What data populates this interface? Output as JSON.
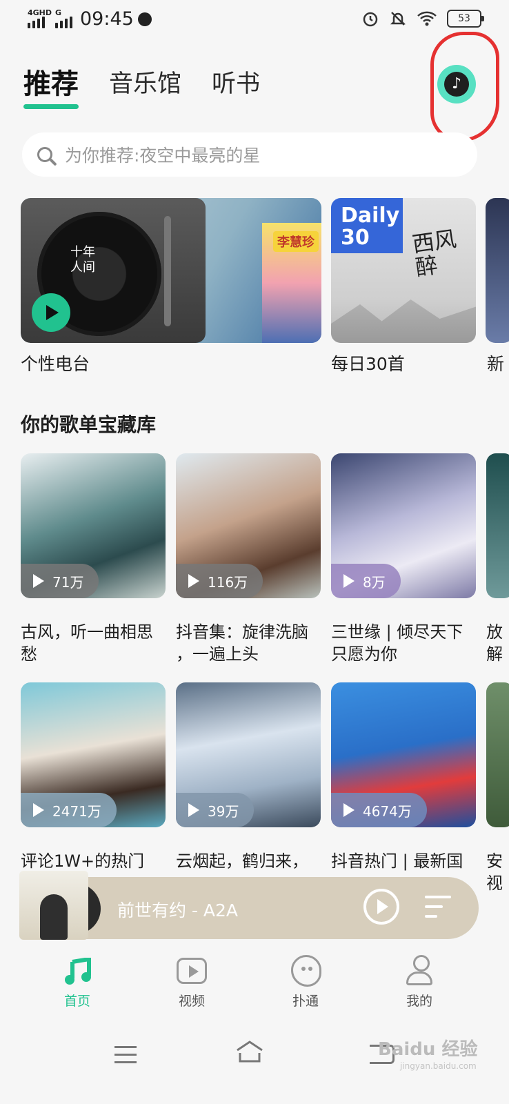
{
  "status_bar": {
    "network1": "4GHD",
    "network2": "G",
    "time": "09:45",
    "battery": "53"
  },
  "tabs": [
    {
      "label": "推荐",
      "active": true
    },
    {
      "label": "音乐馆",
      "active": false
    },
    {
      "label": "听书",
      "active": false
    }
  ],
  "search": {
    "placeholder": "为你推荐:夜空中最亮的星"
  },
  "featured": [
    {
      "label": "个性电台",
      "art_text": "十年\n人间",
      "poster_text": "李慧珍"
    },
    {
      "label": "每日30首",
      "badge": "Daily\n30",
      "art_text": "西风\n醉"
    },
    {
      "label": "新"
    }
  ],
  "section": {
    "title": "你的歌单宝藏库"
  },
  "playlists": [
    {
      "title": "古风，听一曲相思\n愁",
      "plays": "71万"
    },
    {
      "title": "抖音集：旋律洗脑\n，一遍上头",
      "plays": "116万"
    },
    {
      "title": "三世缘 | 倾尽天下\n只愿为你",
      "plays": "8万"
    },
    {
      "title": "放\n解",
      "plays": ""
    },
    {
      "title": "评论1W+的热门",
      "plays": "2471万"
    },
    {
      "title": "云烟起，鹤归来，",
      "plays": "39万"
    },
    {
      "title": "抖音热门 | 最新国",
      "plays": "4674万"
    },
    {
      "title": "安\n视",
      "plays": ""
    }
  ],
  "player": {
    "track": "前世有约 - A2A"
  },
  "bottom_nav": [
    {
      "label": "首页",
      "icon": "music-note-icon",
      "active": true
    },
    {
      "label": "视频",
      "icon": "video-play-icon",
      "active": false
    },
    {
      "label": "扑通",
      "icon": "blob-face-icon",
      "active": false
    },
    {
      "label": "我的",
      "icon": "person-icon",
      "active": false
    }
  ],
  "watermark": {
    "text": "Baidu 经验",
    "sub": "jingyan.baidu.com"
  },
  "colors": {
    "accent": "#21c28f",
    "highlight_circle": "#e53131",
    "player_bg": "#d7cebc"
  }
}
